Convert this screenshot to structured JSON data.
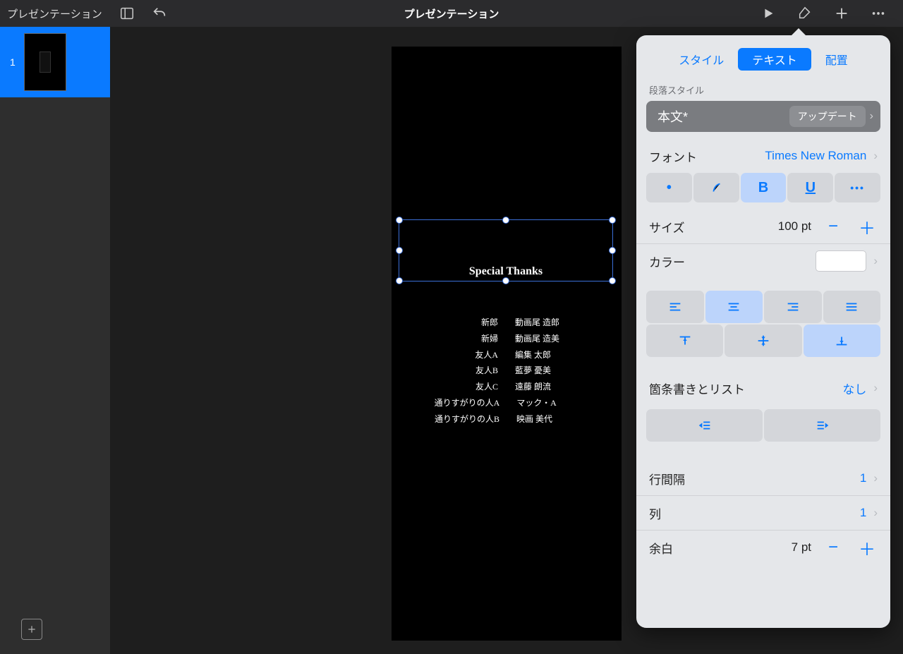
{
  "toolbar": {
    "back_label": "プレゼンテーション",
    "title": "プレゼンテーション"
  },
  "sidebar": {
    "slide_number": "1"
  },
  "slide": {
    "selected_text": "Special Thanks",
    "credits": [
      {
        "role": "新郎",
        "name": "動画尾 造郎"
      },
      {
        "role": "新婦",
        "name": "動画尾 造美"
      },
      {
        "role": "友人A",
        "name": "編集 太郎"
      },
      {
        "role": "友人B",
        "name": "藍夢 憂美"
      },
      {
        "role": "友人C",
        "name": "遠藤 朗流"
      },
      {
        "role": "通りすがりの人A",
        "name": "マック・A"
      },
      {
        "role": "通りすがりの人B",
        "name": "映画 美代"
      }
    ]
  },
  "panel": {
    "tab_style": "スタイル",
    "tab_text": "テキスト",
    "tab_arrange": "配置",
    "paragraph_style_label": "段落スタイル",
    "paragraph_style_name": "本文*",
    "update_label": "アップデート",
    "font_label": "フォント",
    "font_value": "Times New Roman",
    "bold": "B",
    "underline": "U",
    "more": "•••",
    "size_label": "サイズ",
    "size_value": "100 pt",
    "color_label": "カラー",
    "bullets_label": "箇条書きとリスト",
    "bullets_value": "なし",
    "linespacing_label": "行間隔",
    "linespacing_value": "1",
    "columns_label": "列",
    "columns_value": "1",
    "margin_label": "余白",
    "margin_value": "7 pt"
  }
}
